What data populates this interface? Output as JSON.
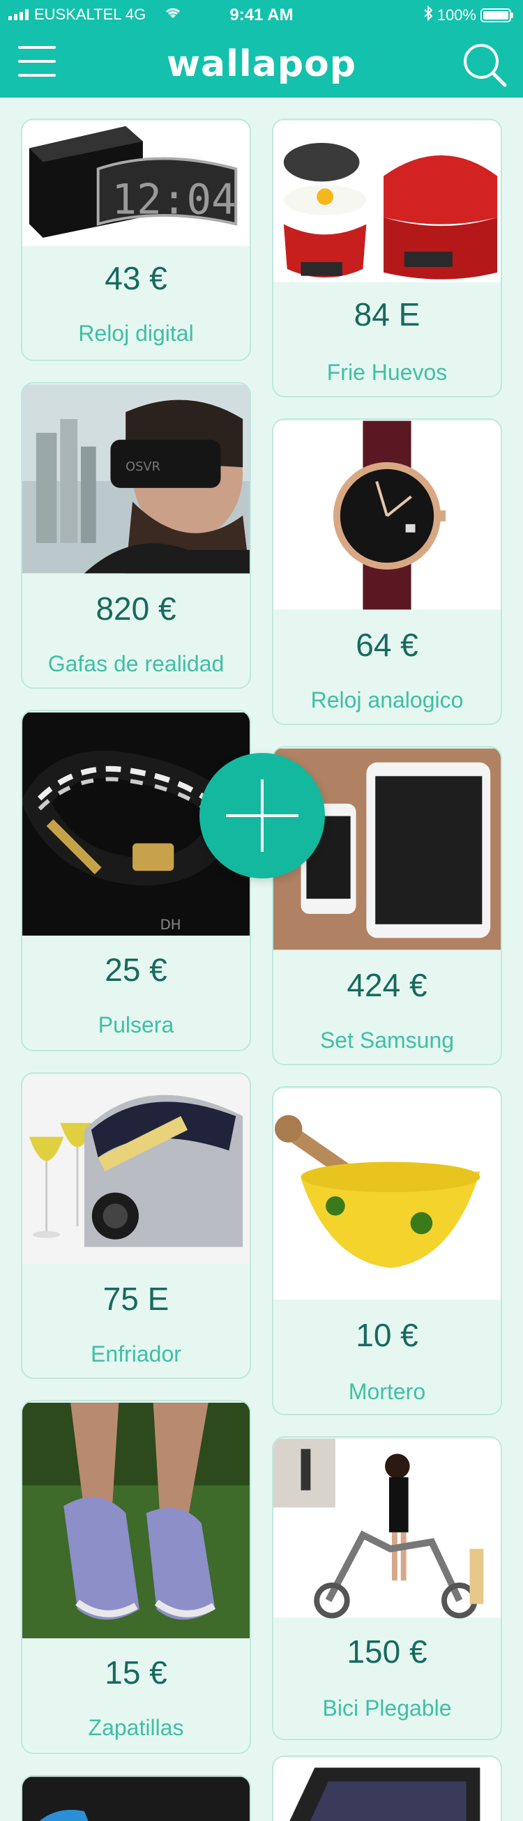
{
  "status_bar": {
    "carrier": "EUSKALTEL 4G",
    "time": "9:41 AM",
    "battery": "100%"
  },
  "header": {
    "logo": "wallapop",
    "menu_icon": "hamburger-icon",
    "search_icon": "search-icon"
  },
  "products": [
    {
      "price": "43 €",
      "title": "Reloj digital"
    },
    {
      "price": "84 E",
      "title": "Frie Huevos"
    },
    {
      "price": "820 €",
      "title": "Gafas de realidad"
    },
    {
      "price": "64 €",
      "title": "Reloj analogico"
    },
    {
      "price": "25 €",
      "title": "Pulsera"
    },
    {
      "price": "424 €",
      "title": "Set Samsung"
    },
    {
      "price": "75 E",
      "title": "Enfriador"
    },
    {
      "price": "10 €",
      "title": "Mortero"
    },
    {
      "price": "15 €",
      "title": "Zapatillas"
    },
    {
      "price": "150 €",
      "title": "Bici Plegable"
    }
  ],
  "colors": {
    "brand": "#13c1ac",
    "background": "#e6f7f2",
    "price": "#166a5c",
    "title": "#3fbfa3"
  },
  "fab_icon": "plus-icon"
}
